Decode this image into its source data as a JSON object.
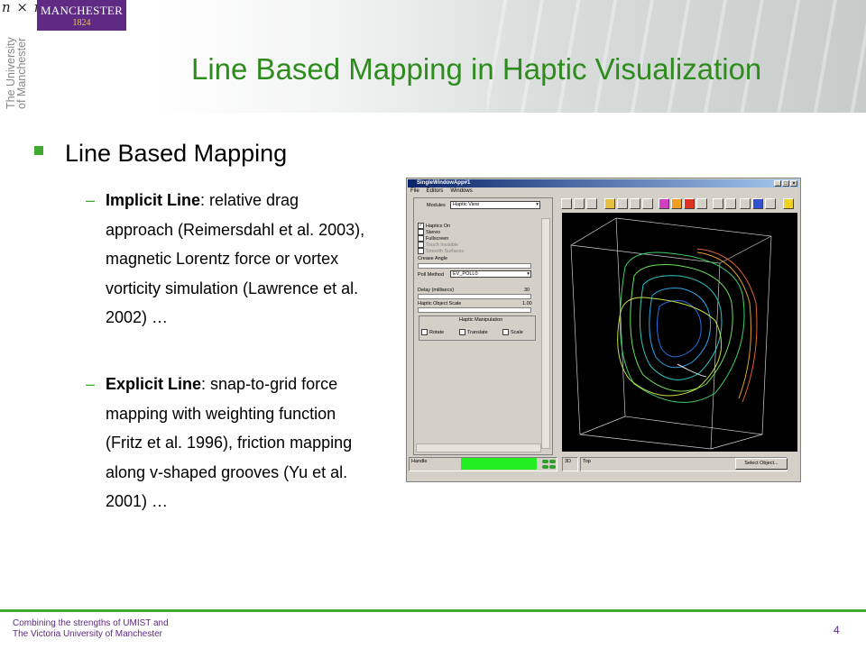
{
  "header": {
    "symbol": "𝑛 × 𝑛",
    "logo_name": "MANCHESTER",
    "logo_year": "1824",
    "university_text": "The University of Manchester"
  },
  "slide": {
    "title": "Line Based Mapping in Haptic Visualization",
    "bullet_heading": "Line Based Mapping",
    "points": [
      {
        "dash": "–",
        "label": "Implicit Line",
        "text": ": relative drag approach (Reimersdahl et al. 2003), magnetic Lorentz force or vortex vorticity simulation (Lawrence et al. 2002) …"
      },
      {
        "dash": "–",
        "label": "Explicit Line",
        "text": ": snap-to-grid force mapping with weighting function (Fritz et al. 1996), friction mapping along v-shaped grooves (Yu et al. 2001) …"
      }
    ]
  },
  "screenshot": {
    "window_title": "SingleWindowApp#1",
    "menu": [
      "File",
      "Editors",
      "Windows"
    ],
    "modules_label": "Modules",
    "modules_value": "Haptic View",
    "checkboxes": [
      {
        "label": "Haptics On",
        "checked": true
      },
      {
        "label": "Stereo",
        "checked": false
      },
      {
        "label": "Fullscreen",
        "checked": false
      },
      {
        "label": "Touch Invisible",
        "checked": false
      },
      {
        "label": "Smooth Surfaces",
        "checked": false
      }
    ],
    "crease_label": "Crease Angle",
    "poll_label": "Poll Method",
    "poll_value": "EV_POLL0",
    "delay_label": "Delay (millisecs)",
    "delay_value": "30",
    "scale_label": "Haptic Object Scale",
    "scale_value": "1.00",
    "group_label": "Haptic Manipulation",
    "group_options": [
      "Rotate",
      "Translate",
      "Scale"
    ],
    "status_handle": "Handle",
    "status_3d": "3D",
    "status_top": "Top",
    "select_button": "Select Object..."
  },
  "footer": {
    "line1": "Combining the strengths of UMIST and",
    "line2": "The Victoria University of Manchester",
    "page_number": "4"
  },
  "colors": {
    "title_green": "#2e8b1e",
    "bullet_green": "#41a832",
    "brand_purple": "#5e2a84",
    "logo_gold": "#f2c94c"
  }
}
